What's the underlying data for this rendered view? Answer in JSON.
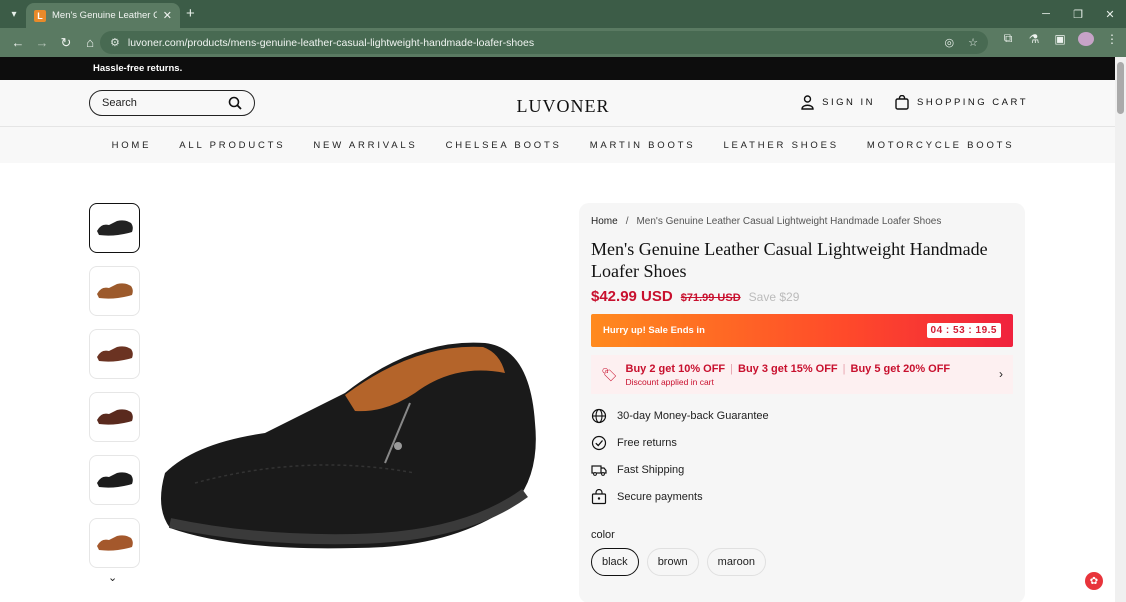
{
  "browser": {
    "tab_title": "Men's Genuine Leather Casual L",
    "favicon_letter": "L",
    "url": "luvoner.com/products/mens-genuine-leather-casual-lightweight-handmade-loafer-shoes"
  },
  "announcement": "Hassle-free returns.",
  "header": {
    "search_placeholder": "Search",
    "logo": "LUVONER",
    "sign_in": "SIGN IN",
    "cart": "SHOPPING CART"
  },
  "menu": [
    "HOME",
    "ALL PRODUCTS",
    "NEW ARRIVALS",
    "CHELSEA BOOTS",
    "MARTIN BOOTS",
    "LEATHER SHOES",
    "MOTORCYCLE BOOTS"
  ],
  "breadcrumb": {
    "home": "Home",
    "separator": "/",
    "current": "Men's Genuine Leather Casual Lightweight Handmade Loafer Shoes"
  },
  "product": {
    "title": "Men's Genuine Leather Casual Lightweight Handmade Loafer Shoes",
    "price": "$42.99 USD",
    "compare_price": "$71.99 USD",
    "save": "Save $29"
  },
  "sale": {
    "text": "Hurry up! Sale Ends in",
    "timer": "04 : 53 : 19.5"
  },
  "discount": {
    "offers": [
      "Buy 2 get 10% OFF",
      "Buy 3 get 15% OFF",
      "Buy 5 get 20% OFF"
    ],
    "note": "Discount applied in cart"
  },
  "features": [
    "30-day Money-back Guarantee",
    "Free returns",
    "Fast Shipping",
    "Secure payments"
  ],
  "color": {
    "label": "color",
    "options": [
      "black",
      "brown",
      "maroon"
    ],
    "selected": "black"
  },
  "thumbnail_colors": [
    "#222222",
    "#9c5a2c",
    "#6b3322",
    "#5a2a1e",
    "#1c1c1c",
    "#a4582c"
  ],
  "colors": {
    "accent": "#c8102e",
    "chrome": "#5a7a62",
    "chrome_dark": "#3c5c47"
  }
}
